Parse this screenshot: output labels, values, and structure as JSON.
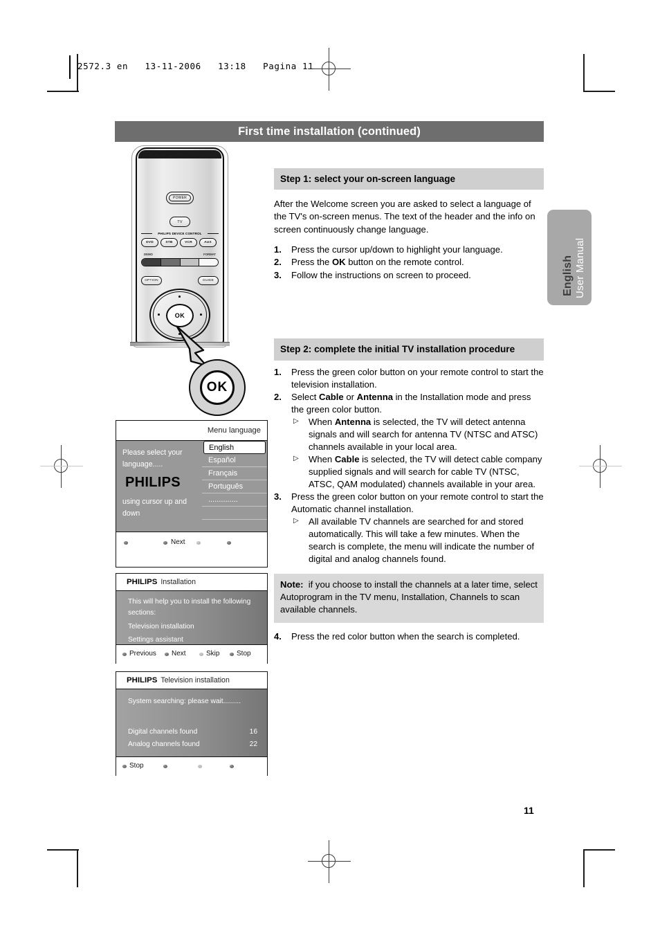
{
  "print": {
    "slug": "2572.3 en   13-11-2006   13:18   Pagina 11"
  },
  "title_bar": {
    "text": "First time installation (continued)"
  },
  "side_tab": {
    "language": "English",
    "manual": "User Manual"
  },
  "page_number": "11",
  "remote": {
    "power_label": "POWER",
    "tv_label": "TV",
    "device_control_label": "PHILIPS DEVICE CONTROL",
    "device_buttons": [
      "DVD",
      "STB",
      "VCR",
      "AUX"
    ],
    "demo_label": "DEMO",
    "format_label": "FORMAT",
    "option_label": "OPTION",
    "guide_label": "GUIDE",
    "ok_label": "OK",
    "callout_ok_label": "OK"
  },
  "step1": {
    "heading": "Step 1: select your on-screen language",
    "intro": "After the Welcome screen you are asked to select a language of the TV's on-screen menus. The text of the header and the info on screen continuously change language.",
    "items": [
      {
        "num": "1.",
        "pre": "Press the cursor up/down to highlight your language.",
        "bold": "",
        "post": ""
      },
      {
        "num": "2.",
        "pre": "Press the ",
        "bold": "OK",
        "post": " button on the remote control."
      },
      {
        "num": "3.",
        "pre": "Follow the instructions on screen to proceed.",
        "bold": "",
        "post": ""
      }
    ]
  },
  "step2": {
    "heading": "Step 2: complete the initial TV installation procedure",
    "item1_num": "1.",
    "item1_text": "Press the green color button on your remote control to start the television installation.",
    "item2_num": "2.",
    "item2_pre": "Select ",
    "item2_b1": "Cable",
    "item2_mid": " or ",
    "item2_b2": "Antenna",
    "item2_post": " in the Installation mode and press the green color button.",
    "sub2a_pre": "When ",
    "sub2a_bold": "Antenna",
    "sub2a_post": " is selected, the TV will detect antenna signals and will search for antenna TV (NTSC and ATSC) channels available in your local area.",
    "sub2b_pre": "When ",
    "sub2b_bold": "Cable",
    "sub2b_post": " is selected, the TV will detect cable company supplied signals and will search for cable TV (NTSC, ATSC, QAM modulated) channels available in your area.",
    "item3_num": "3.",
    "item3_text": "Press the green color button on your remote control to start the Automatic channel installation.",
    "sub3a_text": "All available  TV channels  are searched for and stored automatically. This will take a few minutes. When the search is complete, the menu will indicate the number of digital and analog channels found.",
    "note_label": "Note:",
    "note_text": "if you choose to install the channels at a later time, select Autoprogram in the TV menu, Installation, Channels to scan available channels.",
    "item4_num": "4.",
    "item4_text": "Press the red color button when the search is completed."
  },
  "tv_screen_language": {
    "header_title": "Menu language",
    "prompt_line1": "Please select your",
    "prompt_line2": "language.....",
    "brand": "PHILIPS",
    "prompt_line3": "using cursor up and",
    "prompt_line4": "down",
    "languages": [
      {
        "label": "English",
        "selected": true
      },
      {
        "label": "Español",
        "selected": false
      },
      {
        "label": "Français",
        "selected": false
      },
      {
        "label": "Português",
        "selected": false
      },
      {
        "label": "..............",
        "selected": false
      },
      {
        "label": "",
        "selected": false
      },
      {
        "label": "",
        "selected": false
      }
    ],
    "footer_label": "Next"
  },
  "tv_screen_installation": {
    "brand": "PHILIPS",
    "header_title": "Installation",
    "line1": "This will help you to install the following",
    "line2": "sections:",
    "line3": "Television installation",
    "line4": "Settings assistant",
    "footer": [
      "Previous",
      "Next",
      "Skip",
      "Stop"
    ]
  },
  "tv_screen_television_installation": {
    "brand": "PHILIPS",
    "header_title": "Television installation",
    "status": "System searching: please wait.........",
    "rows": [
      {
        "label": "Digital channels found",
        "value": "16"
      },
      {
        "label": "Analog channels found",
        "value": "22"
      }
    ],
    "footer_label": "Stop"
  }
}
